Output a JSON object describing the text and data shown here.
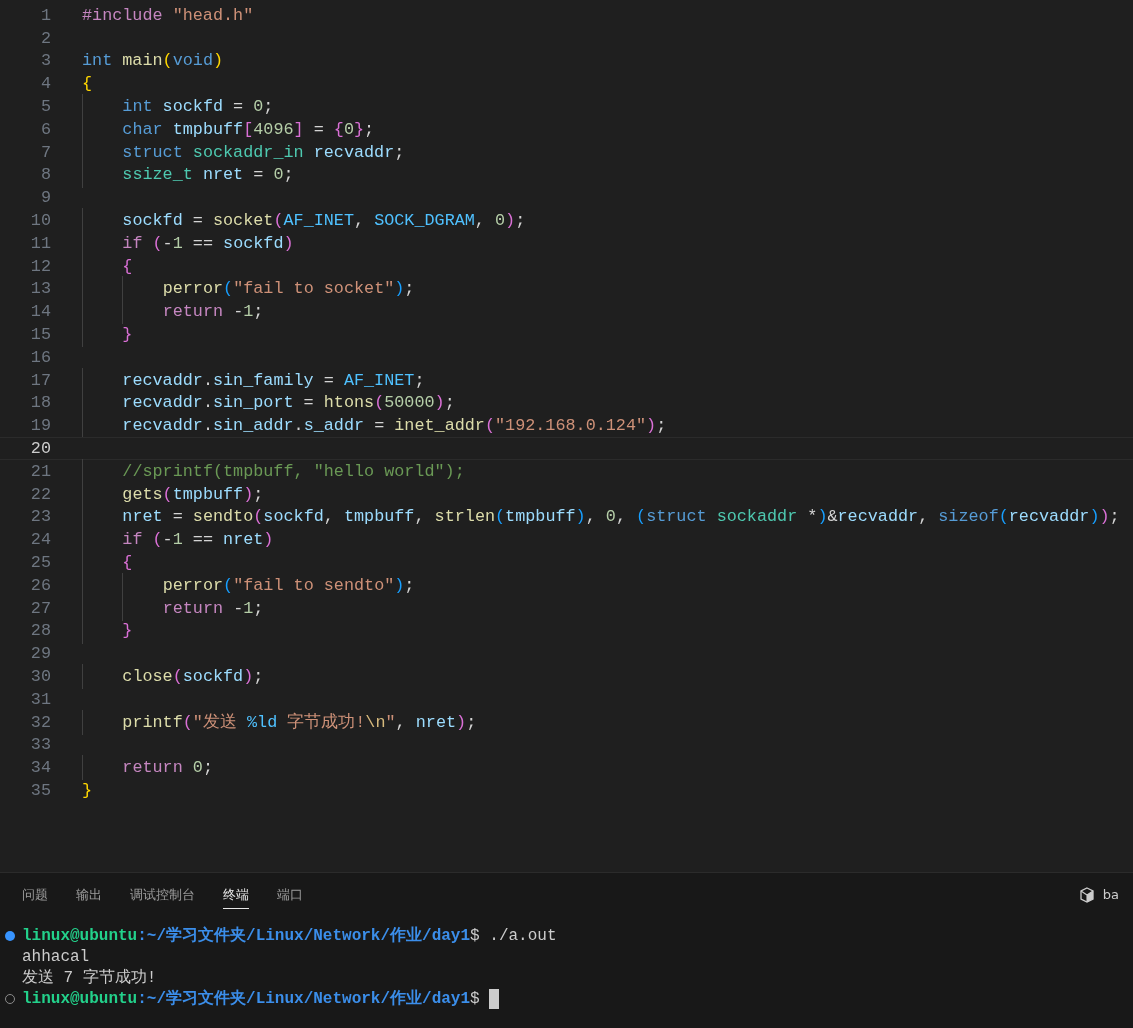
{
  "editor": {
    "lines": [
      {
        "number": "1",
        "current": false,
        "tokens": [
          {
            "kind": "macro",
            "text": "#include "
          },
          {
            "kind": "string",
            "text": "\"head.h\""
          }
        ]
      },
      {
        "number": "2",
        "current": false
      },
      {
        "number": "3",
        "current": false,
        "tokens": [
          {
            "kind": "keyword",
            "text": "int "
          },
          {
            "kind": "func",
            "text": "main"
          },
          {
            "kind": "bracket1",
            "text": "("
          },
          {
            "kind": "keyword",
            "text": "void"
          },
          {
            "kind": "bracket1",
            "text": ")"
          }
        ]
      },
      {
        "number": "4",
        "current": false,
        "tokens": [
          {
            "kind": "bracket1",
            "text": "{"
          }
        ],
        "children": [
          {
            "number": "5",
            "current": false,
            "tokens": [
              {
                "kind": "keyword",
                "text": "int "
              },
              {
                "kind": "var",
                "text": "sockfd"
              },
              {
                "kind": "plain",
                "text": " = "
              },
              {
                "kind": "number",
                "text": "0"
              },
              {
                "kind": "plain",
                "text": ";"
              }
            ]
          },
          {
            "number": "6",
            "current": false,
            "tokens": [
              {
                "kind": "keyword",
                "text": "char "
              },
              {
                "kind": "var",
                "text": "tmpbuff"
              },
              {
                "kind": "bracket2",
                "text": "["
              },
              {
                "kind": "number",
                "text": "4096"
              },
              {
                "kind": "bracket2",
                "text": "]"
              },
              {
                "kind": "plain",
                "text": " = "
              },
              {
                "kind": "bracket2",
                "text": "{"
              },
              {
                "kind": "number",
                "text": "0"
              },
              {
                "kind": "bracket2",
                "text": "}"
              },
              {
                "kind": "plain",
                "text": ";"
              }
            ]
          },
          {
            "number": "7",
            "current": false,
            "tokens": [
              {
                "kind": "keyword",
                "text": "struct "
              },
              {
                "kind": "type",
                "text": "sockaddr_in"
              },
              {
                "kind": "var",
                "text": " recvaddr"
              },
              {
                "kind": "plain",
                "text": ";"
              }
            ]
          },
          {
            "number": "8",
            "current": false,
            "tokens": [
              {
                "kind": "type",
                "text": "ssize_t"
              },
              {
                "kind": "var",
                "text": " nret"
              },
              {
                "kind": "plain",
                "text": " = "
              },
              {
                "kind": "number",
                "text": "0"
              },
              {
                "kind": "plain",
                "text": ";"
              }
            ]
          },
          {
            "number": "9",
            "current": false
          },
          {
            "number": "10",
            "current": false,
            "tokens": [
              {
                "kind": "var",
                "text": "sockfd"
              },
              {
                "kind": "plain",
                "text": " = "
              },
              {
                "kind": "func",
                "text": "socket"
              },
              {
                "kind": "bracket2",
                "text": "("
              },
              {
                "kind": "const",
                "text": "AF_INET"
              },
              {
                "kind": "plain",
                "text": ", "
              },
              {
                "kind": "const",
                "text": "SOCK_DGRAM"
              },
              {
                "kind": "plain",
                "text": ", "
              },
              {
                "kind": "number",
                "text": "0"
              },
              {
                "kind": "bracket2",
                "text": ")"
              },
              {
                "kind": "plain",
                "text": ";"
              }
            ]
          },
          {
            "number": "11",
            "current": false,
            "tokens": [
              {
                "kind": "control",
                "text": "if "
              },
              {
                "kind": "bracket2",
                "text": "("
              },
              {
                "kind": "plain",
                "text": "-"
              },
              {
                "kind": "number",
                "text": "1"
              },
              {
                "kind": "plain",
                "text": " == "
              },
              {
                "kind": "var",
                "text": "sockfd"
              },
              {
                "kind": "bracket2",
                "text": ")"
              }
            ]
          },
          {
            "number": "12",
            "current": false,
            "tokens": [
              {
                "kind": "bracket2",
                "text": "{"
              }
            ],
            "children": [
              {
                "number": "13",
                "current": false,
                "tokens": [
                  {
                    "kind": "func",
                    "text": "perror"
                  },
                  {
                    "kind": "bracket3",
                    "text": "("
                  },
                  {
                    "kind": "string",
                    "text": "\"fail to socket\""
                  },
                  {
                    "kind": "bracket3",
                    "text": ")"
                  },
                  {
                    "kind": "plain",
                    "text": ";"
                  }
                ]
              },
              {
                "number": "14",
                "current": false,
                "tokens": [
                  {
                    "kind": "control",
                    "text": "return "
                  },
                  {
                    "kind": "plain",
                    "text": "-"
                  },
                  {
                    "kind": "number",
                    "text": "1"
                  },
                  {
                    "kind": "plain",
                    "text": ";"
                  }
                ]
              }
            ]
          },
          {
            "number": "15",
            "current": false,
            "tokens": [
              {
                "kind": "bracket2",
                "text": "}"
              }
            ]
          },
          {
            "number": "16",
            "current": false
          },
          {
            "number": "17",
            "current": false,
            "tokens": [
              {
                "kind": "var",
                "text": "recvaddr"
              },
              {
                "kind": "plain",
                "text": "."
              },
              {
                "kind": "var",
                "text": "sin_family"
              },
              {
                "kind": "plain",
                "text": " = "
              },
              {
                "kind": "const",
                "text": "AF_INET"
              },
              {
                "kind": "plain",
                "text": ";"
              }
            ]
          },
          {
            "number": "18",
            "current": false,
            "tokens": [
              {
                "kind": "var",
                "text": "recvaddr"
              },
              {
                "kind": "plain",
                "text": "."
              },
              {
                "kind": "var",
                "text": "sin_port"
              },
              {
                "kind": "plain",
                "text": " = "
              },
              {
                "kind": "func",
                "text": "htons"
              },
              {
                "kind": "bracket2",
                "text": "("
              },
              {
                "kind": "number",
                "text": "50000"
              },
              {
                "kind": "bracket2",
                "text": ")"
              },
              {
                "kind": "plain",
                "text": ";"
              }
            ]
          },
          {
            "number": "19",
            "current": false,
            "tokens": [
              {
                "kind": "var",
                "text": "recvaddr"
              },
              {
                "kind": "plain",
                "text": "."
              },
              {
                "kind": "var",
                "text": "sin_addr"
              },
              {
                "kind": "plain",
                "text": "."
              },
              {
                "kind": "var",
                "text": "s_addr"
              },
              {
                "kind": "plain",
                "text": " = "
              },
              {
                "kind": "func",
                "text": "inet_addr"
              },
              {
                "kind": "bracket2",
                "text": "("
              },
              {
                "kind": "string",
                "text": "\"192.168.0.124\""
              },
              {
                "kind": "bracket2",
                "text": ")"
              },
              {
                "kind": "plain",
                "text": ";"
              }
            ]
          },
          {
            "number": "20",
            "current": true
          },
          {
            "number": "21",
            "current": false,
            "tokens": [
              {
                "kind": "comment",
                "text": "//sprintf(tmpbuff, \"hello world\");"
              }
            ]
          },
          {
            "number": "22",
            "current": false,
            "tokens": [
              {
                "kind": "func",
                "text": "gets"
              },
              {
                "kind": "bracket2",
                "text": "("
              },
              {
                "kind": "var",
                "text": "tmpbuff"
              },
              {
                "kind": "bracket2",
                "text": ")"
              },
              {
                "kind": "plain",
                "text": ";"
              }
            ]
          },
          {
            "number": "23",
            "current": false,
            "tokens": [
              {
                "kind": "var",
                "text": "nret"
              },
              {
                "kind": "plain",
                "text": " = "
              },
              {
                "kind": "func",
                "text": "sendto"
              },
              {
                "kind": "bracket2",
                "text": "("
              },
              {
                "kind": "var",
                "text": "sockfd"
              },
              {
                "kind": "plain",
                "text": ", "
              },
              {
                "kind": "var",
                "text": "tmpbuff"
              },
              {
                "kind": "plain",
                "text": ", "
              },
              {
                "kind": "func",
                "text": "strlen"
              },
              {
                "kind": "bracket3",
                "text": "("
              },
              {
                "kind": "var",
                "text": "tmpbuff"
              },
              {
                "kind": "bracket3",
                "text": ")"
              },
              {
                "kind": "plain",
                "text": ", "
              },
              {
                "kind": "number",
                "text": "0"
              },
              {
                "kind": "plain",
                "text": ", "
              },
              {
                "kind": "bracket3",
                "text": "("
              },
              {
                "kind": "keyword",
                "text": "struct "
              },
              {
                "kind": "type",
                "text": "sockaddr"
              },
              {
                "kind": "plain",
                "text": " *"
              },
              {
                "kind": "bracket3",
                "text": ")"
              },
              {
                "kind": "plain",
                "text": "&"
              },
              {
                "kind": "var",
                "text": "recvaddr"
              },
              {
                "kind": "plain",
                "text": ", "
              },
              {
                "kind": "keyword",
                "text": "sizeof"
              },
              {
                "kind": "bracket3",
                "text": "("
              },
              {
                "kind": "var",
                "text": "recvaddr"
              },
              {
                "kind": "bracket3",
                "text": ")"
              },
              {
                "kind": "bracket2",
                "text": ")"
              },
              {
                "kind": "plain",
                "text": ";"
              }
            ]
          },
          {
            "number": "24",
            "current": false,
            "tokens": [
              {
                "kind": "control",
                "text": "if "
              },
              {
                "kind": "bracket2",
                "text": "("
              },
              {
                "kind": "plain",
                "text": "-"
              },
              {
                "kind": "number",
                "text": "1"
              },
              {
                "kind": "plain",
                "text": " == "
              },
              {
                "kind": "var",
                "text": "nret"
              },
              {
                "kind": "bracket2",
                "text": ")"
              }
            ]
          },
          {
            "number": "25",
            "current": false,
            "tokens": [
              {
                "kind": "bracket2",
                "text": "{"
              }
            ],
            "children": [
              {
                "number": "26",
                "current": false,
                "tokens": [
                  {
                    "kind": "func",
                    "text": "perror"
                  },
                  {
                    "kind": "bracket3",
                    "text": "("
                  },
                  {
                    "kind": "string",
                    "text": "\"fail to sendto\""
                  },
                  {
                    "kind": "bracket3",
                    "text": ")"
                  },
                  {
                    "kind": "plain",
                    "text": ";"
                  }
                ]
              },
              {
                "number": "27",
                "current": false,
                "tokens": [
                  {
                    "kind": "control",
                    "text": "return "
                  },
                  {
                    "kind": "plain",
                    "text": "-"
                  },
                  {
                    "kind": "number",
                    "text": "1"
                  },
                  {
                    "kind": "plain",
                    "text": ";"
                  }
                ]
              }
            ]
          },
          {
            "number": "28",
            "current": false,
            "tokens": [
              {
                "kind": "bracket2",
                "text": "}"
              }
            ]
          },
          {
            "number": "29",
            "current": false
          },
          {
            "number": "30",
            "current": false,
            "tokens": [
              {
                "kind": "func",
                "text": "close"
              },
              {
                "kind": "bracket2",
                "text": "("
              },
              {
                "kind": "var",
                "text": "sockfd"
              },
              {
                "kind": "bracket2",
                "text": ")"
              },
              {
                "kind": "plain",
                "text": ";"
              }
            ]
          },
          {
            "number": "31",
            "current": false
          },
          {
            "number": "32",
            "current": false,
            "tokens": [
              {
                "kind": "func",
                "text": "printf"
              },
              {
                "kind": "bracket2",
                "text": "("
              },
              {
                "kind": "string",
                "text": "\"发送 "
              },
              {
                "kind": "const",
                "text": "%ld"
              },
              {
                "kind": "string",
                "text": " 字节成功!"
              },
              {
                "kind": "escape",
                "text": "\\n"
              },
              {
                "kind": "string",
                "text": "\""
              },
              {
                "kind": "plain",
                "text": ", "
              },
              {
                "kind": "var",
                "text": "nret"
              },
              {
                "kind": "bracket2",
                "text": ")"
              },
              {
                "kind": "plain",
                "text": ";"
              }
            ]
          },
          {
            "number": "33",
            "current": false
          },
          {
            "number": "34",
            "current": false,
            "tokens": [
              {
                "kind": "control",
                "text": "return "
              },
              {
                "kind": "number",
                "text": "0"
              },
              {
                "kind": "plain",
                "text": ";"
              }
            ]
          }
        ]
      },
      {
        "number": "35",
        "current": false,
        "tokens": [
          {
            "kind": "bracket1",
            "text": "}"
          }
        ]
      }
    ]
  },
  "panel": {
    "tabs": [
      {
        "label": "问题",
        "selected": false
      },
      {
        "label": "输出",
        "selected": false
      },
      {
        "label": "调试控制台",
        "selected": false
      },
      {
        "label": "终端",
        "selected": true
      },
      {
        "label": "端口",
        "selected": false
      }
    ],
    "terminal_name": "ba",
    "terminal": [
      {
        "kind": "prompt",
        "finished": true,
        "user": "linux@ubuntu",
        "path": ":~/学习文件夹/Linux/Network/作业/day1",
        "symbol": "$",
        "command": " ./a.out",
        "cursor": false
      },
      {
        "kind": "output",
        "text": "ahhacal"
      },
      {
        "kind": "output",
        "text": "发送 7 字节成功!"
      },
      {
        "kind": "prompt",
        "finished": false,
        "user": "linux@ubuntu",
        "path": ":~/学习文件夹/Linux/Network/作业/day1",
        "symbol": "$",
        "cursor": true
      }
    ]
  }
}
